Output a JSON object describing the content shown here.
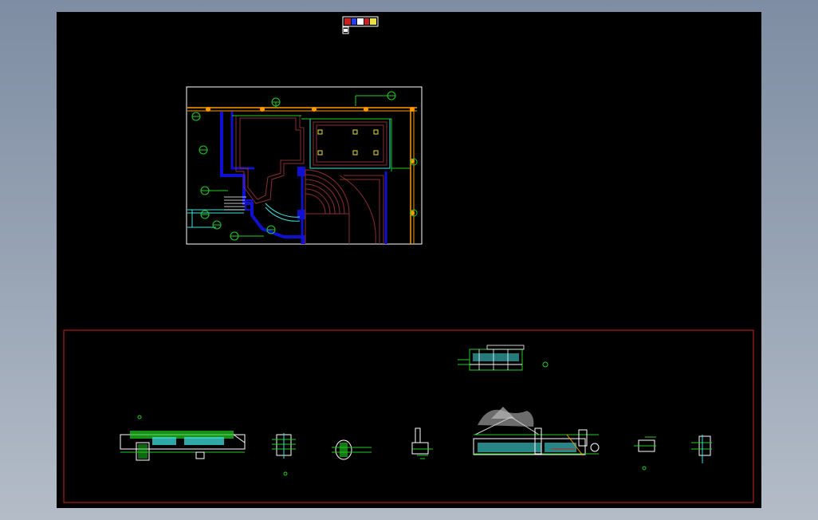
{
  "viewport": {
    "background": "#000000",
    "app_background": "#8d9aae"
  },
  "colors": {
    "sheet_border": "#ffffff",
    "frame_border": "#cc2020",
    "wall_blue": "#1010d0",
    "column_orange": "#ff9a00",
    "grid_green": "#22cc22",
    "cyan": "#40e0e0",
    "maroon": "#8a3030",
    "yellow": "#e8e040"
  },
  "drawings": {
    "title_block": {
      "name": "title-block"
    },
    "floor_plan": {
      "name": "floor-plan",
      "axis_bubble_count": 11
    },
    "elevation_frame": {
      "name": "elevation-frame"
    },
    "detail_items": [
      "long-section",
      "column-detail-1",
      "column-detail-2",
      "column-detail-3",
      "landscape-elevation",
      "column-detail-4",
      "column-detail-5",
      "small-elevation"
    ]
  }
}
